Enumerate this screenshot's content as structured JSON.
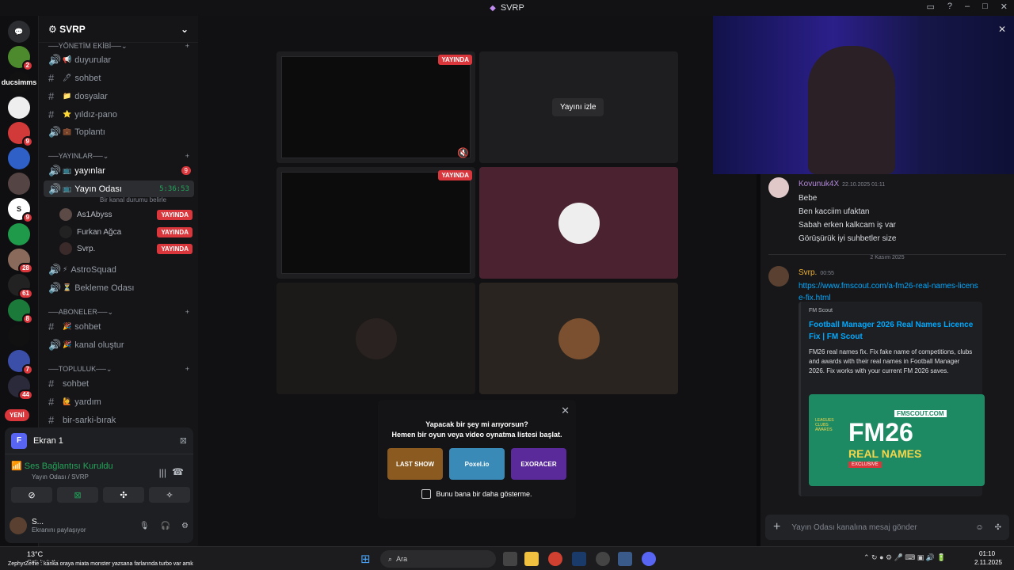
{
  "window": {
    "title": "SVRP"
  },
  "rail": {
    "servers": [
      {
        "label": "",
        "badge": "2",
        "color": "#4c8a2d"
      },
      {
        "label": "ducsimms",
        "badge": "",
        "color": "#111111"
      },
      {
        "label": "",
        "badge": "",
        "color": "#eeeeee"
      },
      {
        "label": "",
        "badge": "9",
        "color": "#d23a3a"
      },
      {
        "label": "",
        "badge": "",
        "color": "#2e60c8"
      },
      {
        "label": "",
        "badge": "",
        "color": "#554444"
      },
      {
        "label": "S",
        "badge": "9",
        "color": "#ffffff"
      },
      {
        "label": "",
        "badge": "",
        "color": "#1f9a4a"
      },
      {
        "label": "",
        "badge": "28",
        "color": "#8a6a5a"
      },
      {
        "label": "",
        "badge": "61",
        "color": "#222222"
      },
      {
        "label": "",
        "badge": "8",
        "color": "#1b7a3a"
      },
      {
        "label": "",
        "badge": "",
        "color": "#111111"
      },
      {
        "label": "",
        "badge": "7",
        "color": "#3b4fa8"
      },
      {
        "label": "",
        "badge": "44",
        "color": "#2a2a3a"
      }
    ],
    "new_label": "YENİ"
  },
  "sidebar": {
    "server_name": "SVRP",
    "categories": {
      "yonetim": "YÖNETİM EKİBİ",
      "yayinlar": "YAYINLAR",
      "aboneler": "ABONELER",
      "topluluk": "TOPLULUK"
    },
    "channels": {
      "duyurular": "duyurular",
      "sohbet1": "sohbet",
      "dosyalar": "dosyalar",
      "yildiz": "yıldız-pano",
      "toplanti": "Toplantı",
      "yayinlar": "yayınlar",
      "yayinlar_badge": "9",
      "yayin_odasi": "Yayın Odası",
      "yayin_timer": "5:36:53",
      "kanal_durumu": "Bir kanal durumu belirle",
      "astro": "AstroSquad",
      "bekleme": "Bekleme Odası",
      "sohbet2": "sohbet",
      "kanal_olustur": "kanal oluştur",
      "sohbet3": "sohbet",
      "yardim": "yardım",
      "sarki": "bir-sarki-bırak"
    },
    "voice_users": [
      {
        "name": "As1Abyss",
        "status": "YAYINDA"
      },
      {
        "name": "Furkan Ağca",
        "status": "YAYINDA"
      },
      {
        "name": "Svrp.",
        "status": "YAYINDA"
      }
    ]
  },
  "panel": {
    "screen_label": "Ekran 1",
    "screen_letter": "F",
    "connection": "Ses Bağlantısı Kuruldu",
    "connection_sub": "Yayın Odası / SVRP",
    "user_name": "S...",
    "user_status": "Ekranını paylaşıyor"
  },
  "stage": {
    "live_label": "YAYINDA",
    "watch_label": "Yayını izle",
    "prompt_line1": "Yapacak bir şey mi arıyorsun?",
    "prompt_line2": "Hemen bir oyun veya video oynatma listesi başlat.",
    "games": [
      "LAST SHOW",
      "Poxel.io",
      "EXORACER"
    ],
    "dont_show": "Bunu bana bir daha gösterme."
  },
  "chat": {
    "msg1": {
      "author": "Kovunuk4X",
      "time": "22.10.2025 01:11",
      "lines": [
        "Bebe",
        "Ben kacciim ufaktan",
        "Sabah erken kalkcam  iş var",
        "Görüşürük iyi suhbetler size"
      ]
    },
    "date_divider": "2 Kasım 2025",
    "msg2": {
      "author": "Svrp.",
      "time": "00:55",
      "link": "https://www.fmscout.com/a-fm26-real-names-license-fix.html"
    },
    "embed": {
      "provider": "FM Scout",
      "title": "Football Manager 2026 Real Names Licence Fix | FM Scout",
      "description": "FM26 real names fix. Fix fake name of competitions, clubs and awards with their real names in Football Manager 2026. Fix works with your current FM 2026 saves.",
      "image_site": "FMSCOUT.COM",
      "image_title": "FM26",
      "image_sub": "REAL NAMES",
      "image_tag": "EXCLUSIVE",
      "image_badge": "LEAGUES CLUBS AWARDS"
    },
    "input_placeholder": "Yayın Odası kanalına mesaj gönder"
  },
  "taskbar": {
    "weather_temp": "13°C",
    "weather_desc": "Çok bulutlu",
    "ticker": "ZephyrZeffie : kanka oraya miata monster yazsana farlarında turbo var amk",
    "search": "Ara",
    "time": "01:10",
    "date": "2.11.2025"
  },
  "colors": {
    "accent": "#5865f2",
    "live": "#da373c",
    "online": "#23a55a",
    "link": "#00a8fc"
  }
}
